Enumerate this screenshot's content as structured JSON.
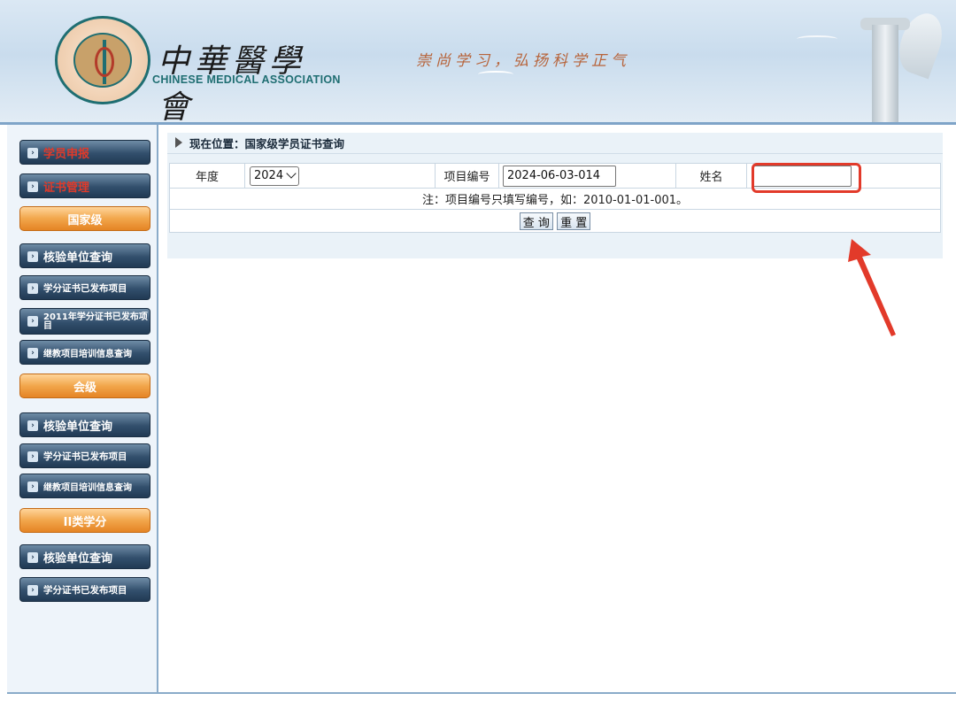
{
  "header": {
    "cn_name": "中華醫學會",
    "en_name": "CHINESE MEDICAL ASSOCIATION",
    "motto": "崇尚学习，弘扬科学正气"
  },
  "sidebar": {
    "top_items": [
      {
        "label": "学员申报"
      },
      {
        "label": "证书管理"
      }
    ],
    "sections": [
      {
        "title": "国家级",
        "items": [
          {
            "label": "核验单位查询"
          },
          {
            "label": "学分证书已发布项目"
          },
          {
            "label": "2011年学分证书已发布项目"
          },
          {
            "label": "继教项目培训信息查询"
          }
        ]
      },
      {
        "title": "会级",
        "items": [
          {
            "label": "核验单位查询"
          },
          {
            "label": "学分证书已发布项目"
          },
          {
            "label": "继教项目培训信息查询"
          }
        ]
      },
      {
        "title": "II类学分",
        "items": [
          {
            "label": "核验单位查询"
          },
          {
            "label": "学分证书已发布项目"
          }
        ]
      }
    ]
  },
  "breadcrumb": "现在位置：国家级学员证书查询",
  "form": {
    "year_label": "年度",
    "year_value": "2024",
    "project_label": "项目编号",
    "project_value": "2024-06-03-014",
    "name_label": "姓名",
    "name_value": "",
    "note": "注：项目编号只填写编号，如：2010-01-01-001。",
    "query_button": "查 询",
    "reset_button": "重 置"
  },
  "colors": {
    "annotation": "#e23a2a",
    "nav_dark": "#324f6c",
    "section_orange": "#f2a64b"
  }
}
